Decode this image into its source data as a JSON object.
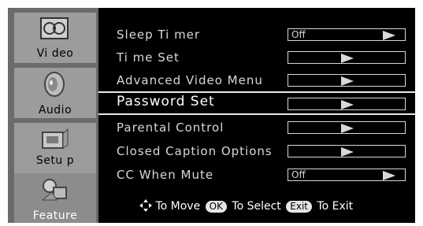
{
  "sidebar": {
    "items": [
      {
        "label": "Vi deo",
        "icon": "video-icon"
      },
      {
        "label": "Audio",
        "icon": "speaker-icon"
      },
      {
        "label": "Setu p",
        "icon": "setup-icon"
      },
      {
        "label": "Feature",
        "icon": "feature-icon"
      }
    ]
  },
  "menu": {
    "items": [
      {
        "label": "Sleep Ti mer",
        "value": "Off"
      },
      {
        "label": "Ti me Set",
        "value": ""
      },
      {
        "label": "Advanced Video Menu",
        "value": ""
      },
      {
        "label": "Password Set",
        "value": ""
      },
      {
        "label": "Parental Control",
        "value": ""
      },
      {
        "label": "Closed Caption Options",
        "value": ""
      },
      {
        "label": "CC When Mute",
        "value": "Off"
      }
    ],
    "selected_index": 3
  },
  "hint": {
    "move": "To Move",
    "ok_key": "OK",
    "select": "To Select",
    "exit_key": "Exit",
    "exit": "To Exit"
  }
}
